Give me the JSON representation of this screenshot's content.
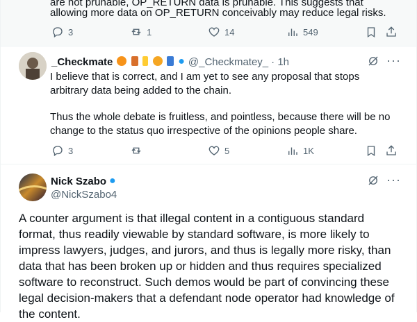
{
  "quoted_tweet": {
    "line1": "are not prunable, OP_RETURN data is prunable. This suggests that",
    "line2": "allowing more data on OP_RETURN conceivably may reduce legal risks.",
    "actions": {
      "replies": "3",
      "reposts": "1",
      "likes": "14",
      "views": "549"
    }
  },
  "reply_tweet": {
    "name": "_Checkmate",
    "handle": "@_Checkmatey_",
    "time": "· 1h",
    "para1_line1": "I believe that is correct, and I am yet to see any proposal that stops",
    "para1_line2": "arbitrary data being added to the chain.",
    "para2_line1": "Thus the whole debate is fruitless, and pointless, because there will be no",
    "para2_line2": "change to the status quo irrespective of the opinions people share.",
    "actions": {
      "replies": "3",
      "reposts": "",
      "likes": "5",
      "views": "1K"
    }
  },
  "main_tweet": {
    "name": "Nick Szabo",
    "handle": "@NickSzabo4",
    "lines": [
      "A counter argument is that illegal content in a contiguous standard",
      "format, thus readily viewable by standard software, is more likely to",
      "impress lawyers, judges, and jurors, and thus is legally more risky, than",
      "data that has been broken up or hidden and thus requires specialized",
      "software to reconstruct.  Such demos would be part of convincing these",
      "legal decision-makers that a defendant node operator had knowledge of",
      "the content."
    ]
  },
  "colors": {
    "accent": "#1d9bf0",
    "muted": "#536471"
  }
}
